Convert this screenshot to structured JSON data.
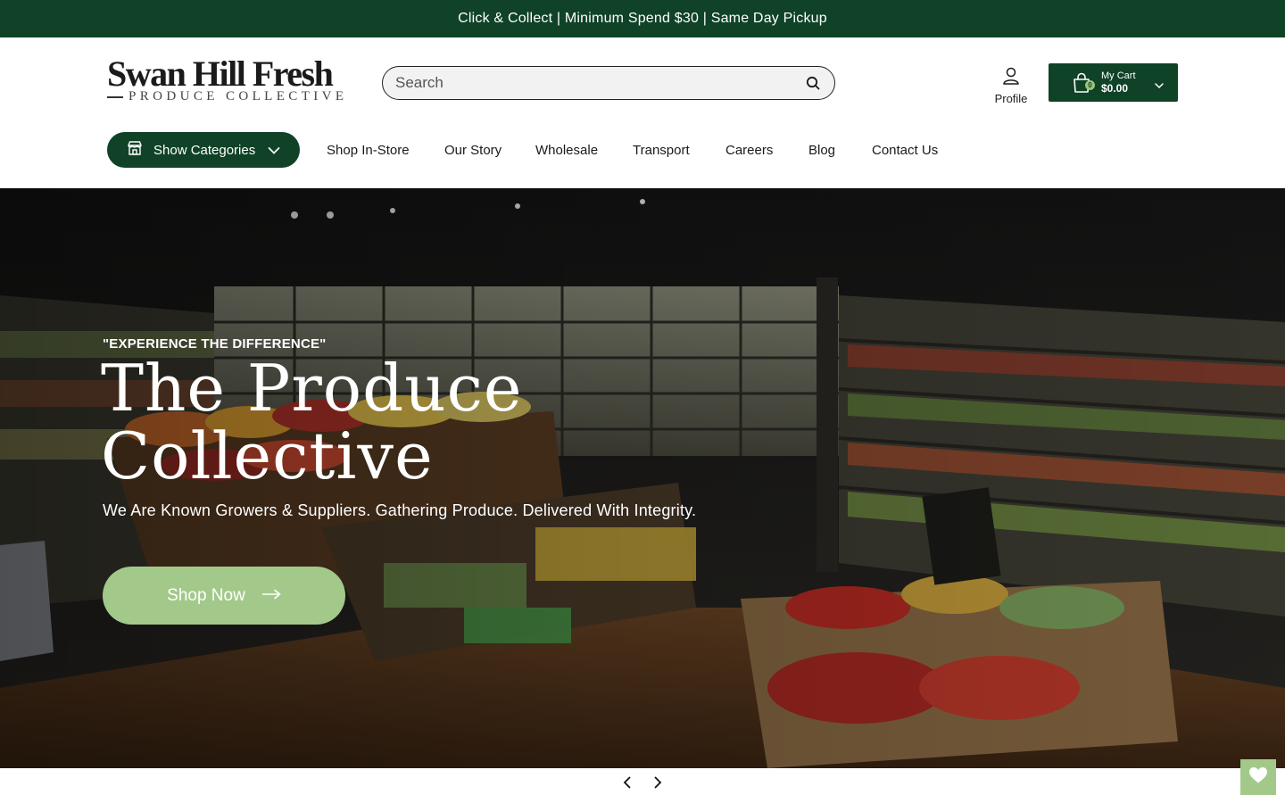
{
  "announcement": {
    "text": "Click & Collect | Minimum Spend $30 | Same Day Pickup"
  },
  "logo": {
    "name": "Swan Hill Fresh",
    "tagline": "PRODUCE COLLECTIVE"
  },
  "search": {
    "placeholder": "Search",
    "icon": "search-icon"
  },
  "account": {
    "profile_label": "Profile",
    "icon": "user-icon"
  },
  "cart": {
    "label": "My Cart",
    "total": "$0.00",
    "count": "0",
    "icon": "shopping-bag-icon"
  },
  "categories_button": {
    "label": "Show Categories",
    "icon": "store-icon"
  },
  "nav": {
    "items": [
      {
        "label": "Shop In-Store"
      },
      {
        "label": "Our Story"
      },
      {
        "label": "Wholesale"
      },
      {
        "label": "Transport"
      },
      {
        "label": "Careers"
      },
      {
        "label": "Blog"
      },
      {
        "label": "Contact Us"
      }
    ]
  },
  "hero": {
    "kicker": "\"EXPERIENCE THE DIFFERENCE\"",
    "title": "The Produce Collective",
    "tagline": "We Are Known Growers & Suppliers. Gathering Produce. Delivered With Integrity.",
    "cta_label": "Shop Now"
  },
  "slider": {
    "prev_icon": "chevron-left-icon",
    "next_icon": "chevron-right-icon"
  },
  "wishlist": {
    "icon": "heart-icon"
  },
  "colors": {
    "brand_green": "#0f4227",
    "accent_green": "#a3c98a",
    "white": "#ffffff"
  }
}
